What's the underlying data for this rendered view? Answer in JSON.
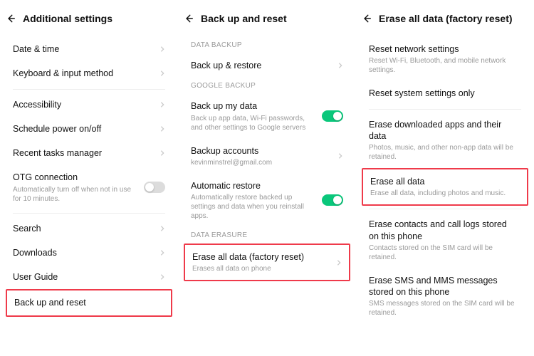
{
  "panel1": {
    "title": "Additional settings",
    "items": {
      "date_time": "Date & time",
      "keyboard": "Keyboard & input method",
      "accessibility": "Accessibility",
      "schedule": "Schedule power on/off",
      "recent_tasks": "Recent tasks manager",
      "otg": "OTG connection",
      "otg_sub": "Automatically turn off when not in use for 10 minutes.",
      "search": "Search",
      "downloads": "Downloads",
      "user_guide": "User Guide",
      "backup_reset": "Back up and reset"
    }
  },
  "panel2": {
    "title": "Back up and reset",
    "sections": {
      "data_backup": "DATA BACKUP",
      "google_backup": "GOOGLE BACKUP",
      "data_erasure": "DATA ERASURE"
    },
    "backup_restore": "Back up & restore",
    "backup_my_data": "Back up my data",
    "backup_my_data_sub": "Back up app data, Wi-Fi passwords, and other settings to Google servers",
    "backup_accounts": "Backup accounts",
    "backup_accounts_sub": "kevinminstrel@gmail.com",
    "auto_restore": "Automatic restore",
    "auto_restore_sub": "Automatically restore backed up settings and data when you reinstall apps.",
    "erase_all": "Erase all data (factory reset)",
    "erase_all_sub": "Erases all data on phone"
  },
  "panel3": {
    "title": "Erase all data (factory reset)",
    "reset_network": "Reset network settings",
    "reset_network_sub": "Reset Wi-Fi, Bluetooth, and mobile network settings.",
    "reset_system": "Reset system settings only",
    "erase_apps": "Erase downloaded apps and their data",
    "erase_apps_sub": "Photos, music, and other non-app data will be retained.",
    "erase_all": "Erase all data",
    "erase_all_sub": "Erase all data, including photos and music.",
    "erase_contacts": "Erase contacts and call logs stored on this phone",
    "erase_contacts_sub": "Contacts stored on the SIM card will be retained.",
    "erase_sms": "Erase SMS and MMS messages stored on this phone",
    "erase_sms_sub": "SMS messages stored on the SIM card will be retained."
  }
}
